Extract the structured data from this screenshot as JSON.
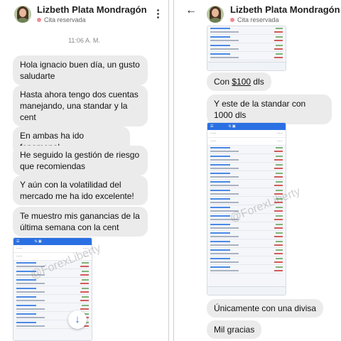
{
  "left": {
    "contact_name": "Lizbeth Plata Mondragón",
    "status": "Cita reservada",
    "time": "11:06 A. M.",
    "messages": [
      "Hola ignacio buen día, un gusto saludarte",
      "Hasta ahora tengo dos cuentas manejando, una standar y la cent",
      "En ambas ha ido fenomenal",
      "He seguido la gestión de riesgo que recomiendas",
      "Y aún con la volatilidad del mercado me ha ido excelente!",
      "Te muestro mis ganancias de la última semana con la cent"
    ],
    "watermark": "@ForexLiberty"
  },
  "right": {
    "contact_name": "Lizbeth Plata Mondragón",
    "status": "Cita reservada",
    "back_icon": "←",
    "msg_prefix": "Con ",
    "msg_amount": "$100",
    "msg_suffix": " dls",
    "messages": [
      "Y este de la standar con 1000 dls",
      "Únicamente con una divisa",
      "Mil gracias"
    ],
    "watermark": "@ForexLiberty"
  },
  "colors": {
    "bubble": "#ebebeb",
    "accent": "#2b70e2",
    "status_dot": "#f08a93"
  },
  "icons": [
    "avatar",
    "kebab-menu-icon",
    "back-arrow-icon",
    "scroll-down-icon",
    "status-dot-icon"
  ]
}
